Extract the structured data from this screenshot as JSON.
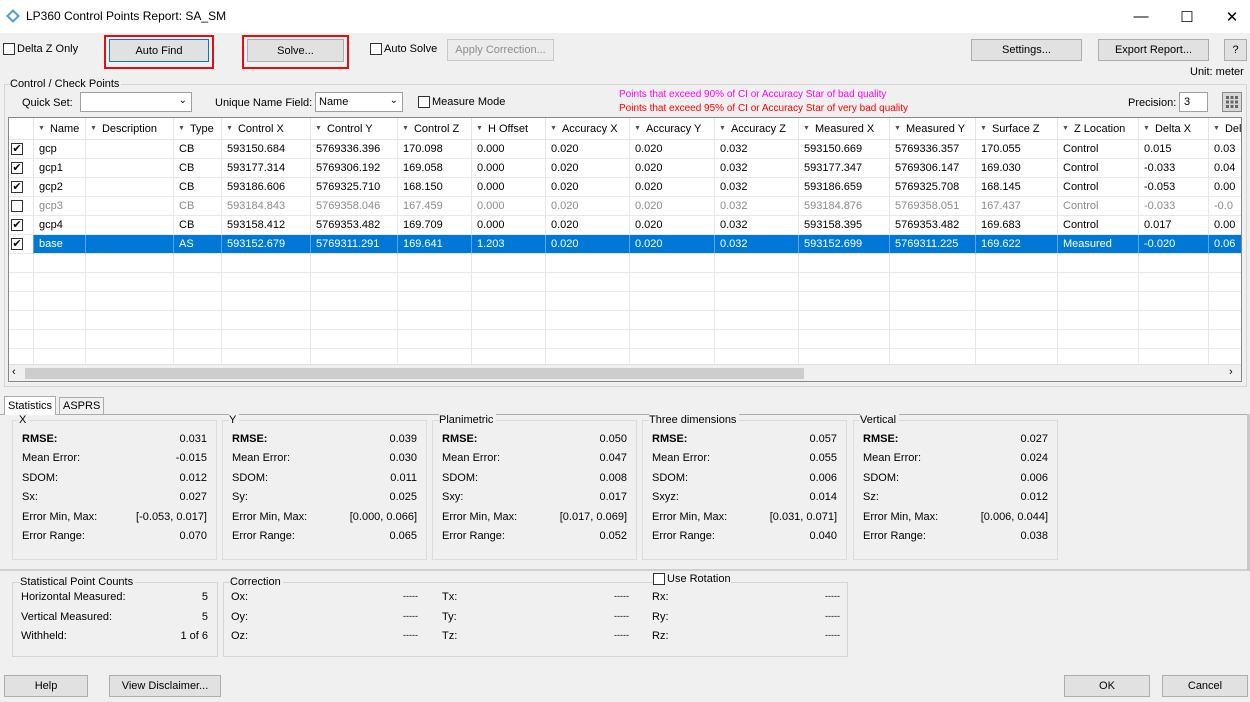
{
  "window": {
    "title": "LP360 Control Points Report: SA_SM",
    "minimize": "—",
    "maximize": "☐",
    "close": "✕"
  },
  "toolbar": {
    "delta_z_only": "Delta Z Only",
    "auto_find": "Auto Find",
    "solve": "Solve...",
    "auto_solve": "Auto Solve",
    "apply_correction": "Apply Correction...",
    "settings": "Settings...",
    "export_report": "Export Report...",
    "help_q": "?",
    "unit": "Unit: meter"
  },
  "cp_group": {
    "title": "Control / Check Points",
    "quick_set_label": "Quick Set:",
    "quick_set_value": "",
    "unique_name_label": "Unique Name Field:",
    "unique_name_value": "Name",
    "measure_mode": "Measure Mode",
    "legend_90": "Points that exceed 90% of CI or Accuracy Star of bad quality",
    "legend_95": "Points that exceed 95% of CI or Accuracy Star of very bad quality",
    "legend_90_color": "#ff00ff",
    "legend_95_color": "#ff0000",
    "precision_label": "Precision:",
    "precision_value": "3"
  },
  "table": {
    "columns": [
      "Name",
      "Description",
      "Type",
      "Control X",
      "Control Y",
      "Control Z",
      "H Offset",
      "Accuracy X",
      "Accuracy Y",
      "Accuracy Z",
      "Measured X",
      "Measured Y",
      "Surface Z",
      "Z Location",
      "Delta X",
      "Del"
    ],
    "rows": [
      {
        "checked": true,
        "state": "normal",
        "cells": [
          "gcp",
          "",
          "CB",
          "593150.684",
          "5769336.396",
          "170.098",
          "0.000",
          "0.020",
          "0.020",
          "0.032",
          "593150.669",
          "5769336.357",
          "170.055",
          "Control",
          "0.015",
          "0.03"
        ]
      },
      {
        "checked": true,
        "state": "normal",
        "cells": [
          "gcp1",
          "",
          "CB",
          "593177.314",
          "5769306.192",
          "169.058",
          "0.000",
          "0.020",
          "0.020",
          "0.032",
          "593177.347",
          "5769306.147",
          "169.030",
          "Control",
          "-0.033",
          "0.04"
        ]
      },
      {
        "checked": true,
        "state": "normal",
        "cells": [
          "gcp2",
          "",
          "CB",
          "593186.606",
          "5769325.710",
          "168.150",
          "0.000",
          "0.020",
          "0.020",
          "0.032",
          "593186.659",
          "5769325.708",
          "168.145",
          "Control",
          "-0.053",
          "0.00"
        ]
      },
      {
        "checked": false,
        "state": "grey",
        "cells": [
          "gcp3",
          "",
          "CB",
          "593184.843",
          "5769358.046",
          "167.459",
          "0.000",
          "0.020",
          "0.020",
          "0.032",
          "593184.876",
          "5769358.051",
          "167.437",
          "Control",
          "-0.033",
          "-0.0"
        ]
      },
      {
        "checked": true,
        "state": "normal",
        "cells": [
          "gcp4",
          "",
          "CB",
          "593158.412",
          "5769353.482",
          "169.709",
          "0.000",
          "0.020",
          "0.020",
          "0.032",
          "593158.395",
          "5769353.482",
          "169.683",
          "Control",
          "0.017",
          "0.00"
        ]
      },
      {
        "checked": true,
        "state": "selected",
        "cells": [
          "base",
          "",
          "AS",
          "593152.679",
          "5769311.291",
          "169.641",
          "1.203",
          "0.020",
          "0.020",
          "0.032",
          "593152.699",
          "5769311.225",
          "169.622",
          "Measured",
          "-0.020",
          "0.06"
        ]
      }
    ]
  },
  "tabs": [
    "Statistics",
    "ASPRS"
  ],
  "stats": [
    {
      "title": "X",
      "rows": [
        [
          "RMSE:",
          "0.031"
        ],
        [
          "Mean Error:",
          "-0.015"
        ],
        [
          "SDOM:",
          "0.012"
        ],
        [
          "Sx:",
          "0.027"
        ],
        [
          "Error Min, Max:",
          "[-0.053, 0.017]"
        ],
        [
          "Error Range:",
          "0.070"
        ]
      ]
    },
    {
      "title": "Y",
      "rows": [
        [
          "RMSE:",
          "0.039"
        ],
        [
          "Mean Error:",
          "0.030"
        ],
        [
          "SDOM:",
          "0.011"
        ],
        [
          "Sy:",
          "0.025"
        ],
        [
          "Error Min, Max:",
          "[0.000, 0.066]"
        ],
        [
          "Error Range:",
          "0.065"
        ]
      ]
    },
    {
      "title": "Planimetric",
      "rows": [
        [
          "RMSE:",
          "0.050"
        ],
        [
          "Mean Error:",
          "0.047"
        ],
        [
          "SDOM:",
          "0.008"
        ],
        [
          "Sxy:",
          "0.017"
        ],
        [
          "Error Min, Max:",
          "[0.017, 0.069]"
        ],
        [
          "Error Range:",
          "0.052"
        ]
      ]
    },
    {
      "title": "Three dimensions",
      "rows": [
        [
          "RMSE:",
          "0.057"
        ],
        [
          "Mean Error:",
          "0.055"
        ],
        [
          "SDOM:",
          "0.006"
        ],
        [
          "Sxyz:",
          "0.014"
        ],
        [
          "Error Min, Max:",
          "[0.031, 0.071]"
        ],
        [
          "Error Range:",
          "0.040"
        ]
      ]
    },
    {
      "title": "Vertical",
      "rows": [
        [
          "RMSE:",
          "0.027"
        ],
        [
          "Mean Error:",
          "0.024"
        ],
        [
          "SDOM:",
          "0.006"
        ],
        [
          "Sz:",
          "0.012"
        ],
        [
          "Error Min, Max:",
          "[0.006, 0.044]"
        ],
        [
          "Error Range:",
          "0.038"
        ]
      ]
    }
  ],
  "counts": {
    "title": "Statistical Point Counts",
    "rows": [
      [
        "Horizontal Measured:",
        "5"
      ],
      [
        "Vertical Measured:",
        "5"
      ],
      [
        "Withheld:",
        "1 of 6"
      ]
    ]
  },
  "correction": {
    "title": "Correction",
    "use_rotation": "Use Rotation",
    "cols": [
      [
        [
          "Ox:",
          "-----"
        ],
        [
          "Oy:",
          "-----"
        ],
        [
          "Oz:",
          "-----"
        ]
      ],
      [
        [
          "Tx:",
          "-----"
        ],
        [
          "Ty:",
          "-----"
        ],
        [
          "Tz:",
          "-----"
        ]
      ],
      [
        [
          "Rx:",
          "-----"
        ],
        [
          "Ry:",
          "-----"
        ],
        [
          "Rz:",
          "-----"
        ]
      ]
    ]
  },
  "footer": {
    "help": "Help",
    "disclaimer": "View Disclaimer...",
    "ok": "OK",
    "cancel": "Cancel"
  }
}
